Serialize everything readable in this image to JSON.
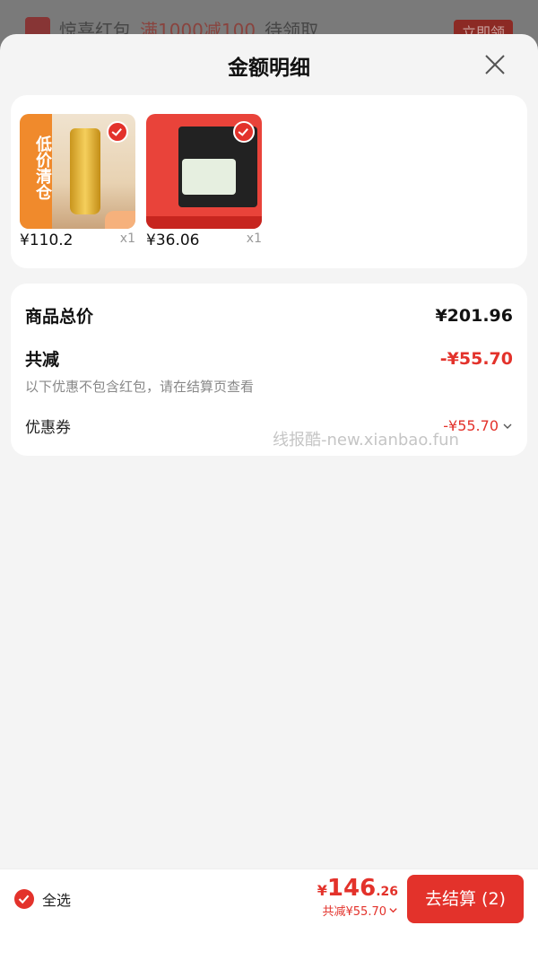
{
  "background": {
    "banner_text_1": "惊喜红包",
    "banner_highlight": "满1000减100",
    "banner_text_2": "待领取",
    "banner_button": "立即领"
  },
  "sheet": {
    "title": "金额明细"
  },
  "products": [
    {
      "price": "¥110.2",
      "qty": "x1",
      "side_text": "低价清仓",
      "selected": true
    },
    {
      "price": "¥36.06",
      "qty": "x1",
      "selected": true
    }
  ],
  "summary": {
    "total_label": "商品总价",
    "total_value": "¥201.96",
    "reduce_label": "共减",
    "reduce_value": "-¥55.70",
    "note": "以下优惠不包含红包，请在结算页查看",
    "coupon_label": "优惠券",
    "coupon_value": "-¥55.70"
  },
  "watermark": "线报酷-new.xianbao.fun",
  "footer": {
    "select_all": "全选",
    "price_currency": "¥",
    "price_int": "146",
    "price_dec": ".26",
    "reduce_text": "共减¥55.70",
    "checkout_label": "去结算 (2)"
  },
  "colors": {
    "accent": "#e3322b"
  }
}
